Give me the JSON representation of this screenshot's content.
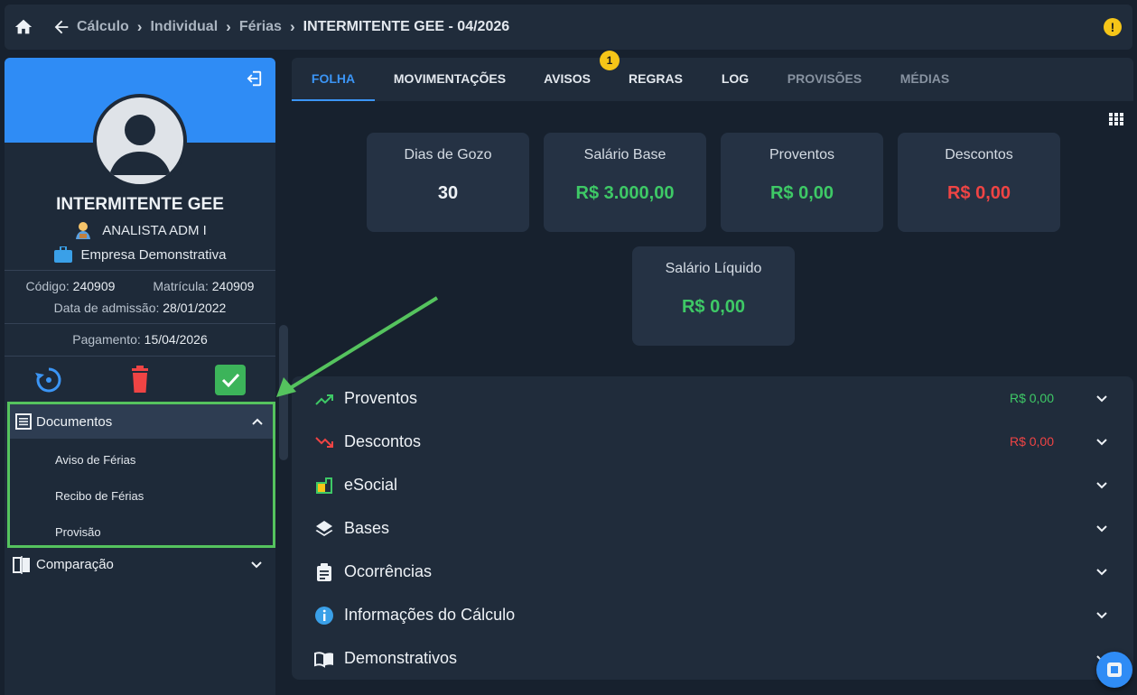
{
  "breadcrumb": [
    "Cálculo",
    "Individual",
    "Férias",
    "INTERMITENTE GEE - 04/2026"
  ],
  "warning_symbol": "!",
  "profile": {
    "name": "INTERMITENTE GEE",
    "role": "ANALISTA ADM I",
    "company": "Empresa Demonstrativa",
    "codigo_label": "Código:",
    "codigo": "240909",
    "matricula_label": "Matrícula:",
    "matricula": "240909",
    "admissao_label": "Data de admissão:",
    "admissao": "28/01/2022",
    "pagamento_label": "Pagamento:",
    "pagamento": "15/04/2026"
  },
  "menu": {
    "documentos": "Documentos",
    "items": [
      "Aviso de Férias",
      "Recibo de Férias",
      "Provisão"
    ],
    "comparacao": "Comparação"
  },
  "tabs": [
    {
      "label": "FOLHA",
      "state": "active"
    },
    {
      "label": "MOVIMENTAÇÕES",
      "state": "normal"
    },
    {
      "label": "AVISOS",
      "state": "normal",
      "badge": "1"
    },
    {
      "label": "REGRAS",
      "state": "normal"
    },
    {
      "label": "LOG",
      "state": "normal"
    },
    {
      "label": "PROVISÕES",
      "state": "disabled"
    },
    {
      "label": "MÉDIAS",
      "state": "disabled"
    }
  ],
  "cards": [
    {
      "title": "Dias de Gozo",
      "value": "30",
      "color": "white"
    },
    {
      "title": "Salário Base",
      "value": "R$ 3.000,00",
      "color": "green"
    },
    {
      "title": "Proventos",
      "value": "R$ 0,00",
      "color": "green"
    },
    {
      "title": "Descontos",
      "value": "R$ 0,00",
      "color": "red"
    },
    {
      "title": "Salário Líquido",
      "value": "R$ 0,00",
      "color": "green"
    }
  ],
  "sections": [
    {
      "label": "Proventos",
      "amount": "R$ 0,00",
      "icon": "trending-up-icon"
    },
    {
      "label": "Descontos",
      "amount": "R$ 0,00",
      "icon": "trending-down-icon"
    },
    {
      "label": "eSocial",
      "icon": "esocial-icon"
    },
    {
      "label": "Bases",
      "icon": "layers-icon"
    },
    {
      "label": "Ocorrências",
      "icon": "clipboard-icon"
    },
    {
      "label": "Informações do Cálculo",
      "icon": "info-icon"
    },
    {
      "label": "Demonstrativos",
      "icon": "book-icon"
    }
  ],
  "colors": {
    "accent": "#2f8cf5",
    "green": "#3ec966",
    "red": "#ef4444",
    "highlight": "#55c35e"
  }
}
